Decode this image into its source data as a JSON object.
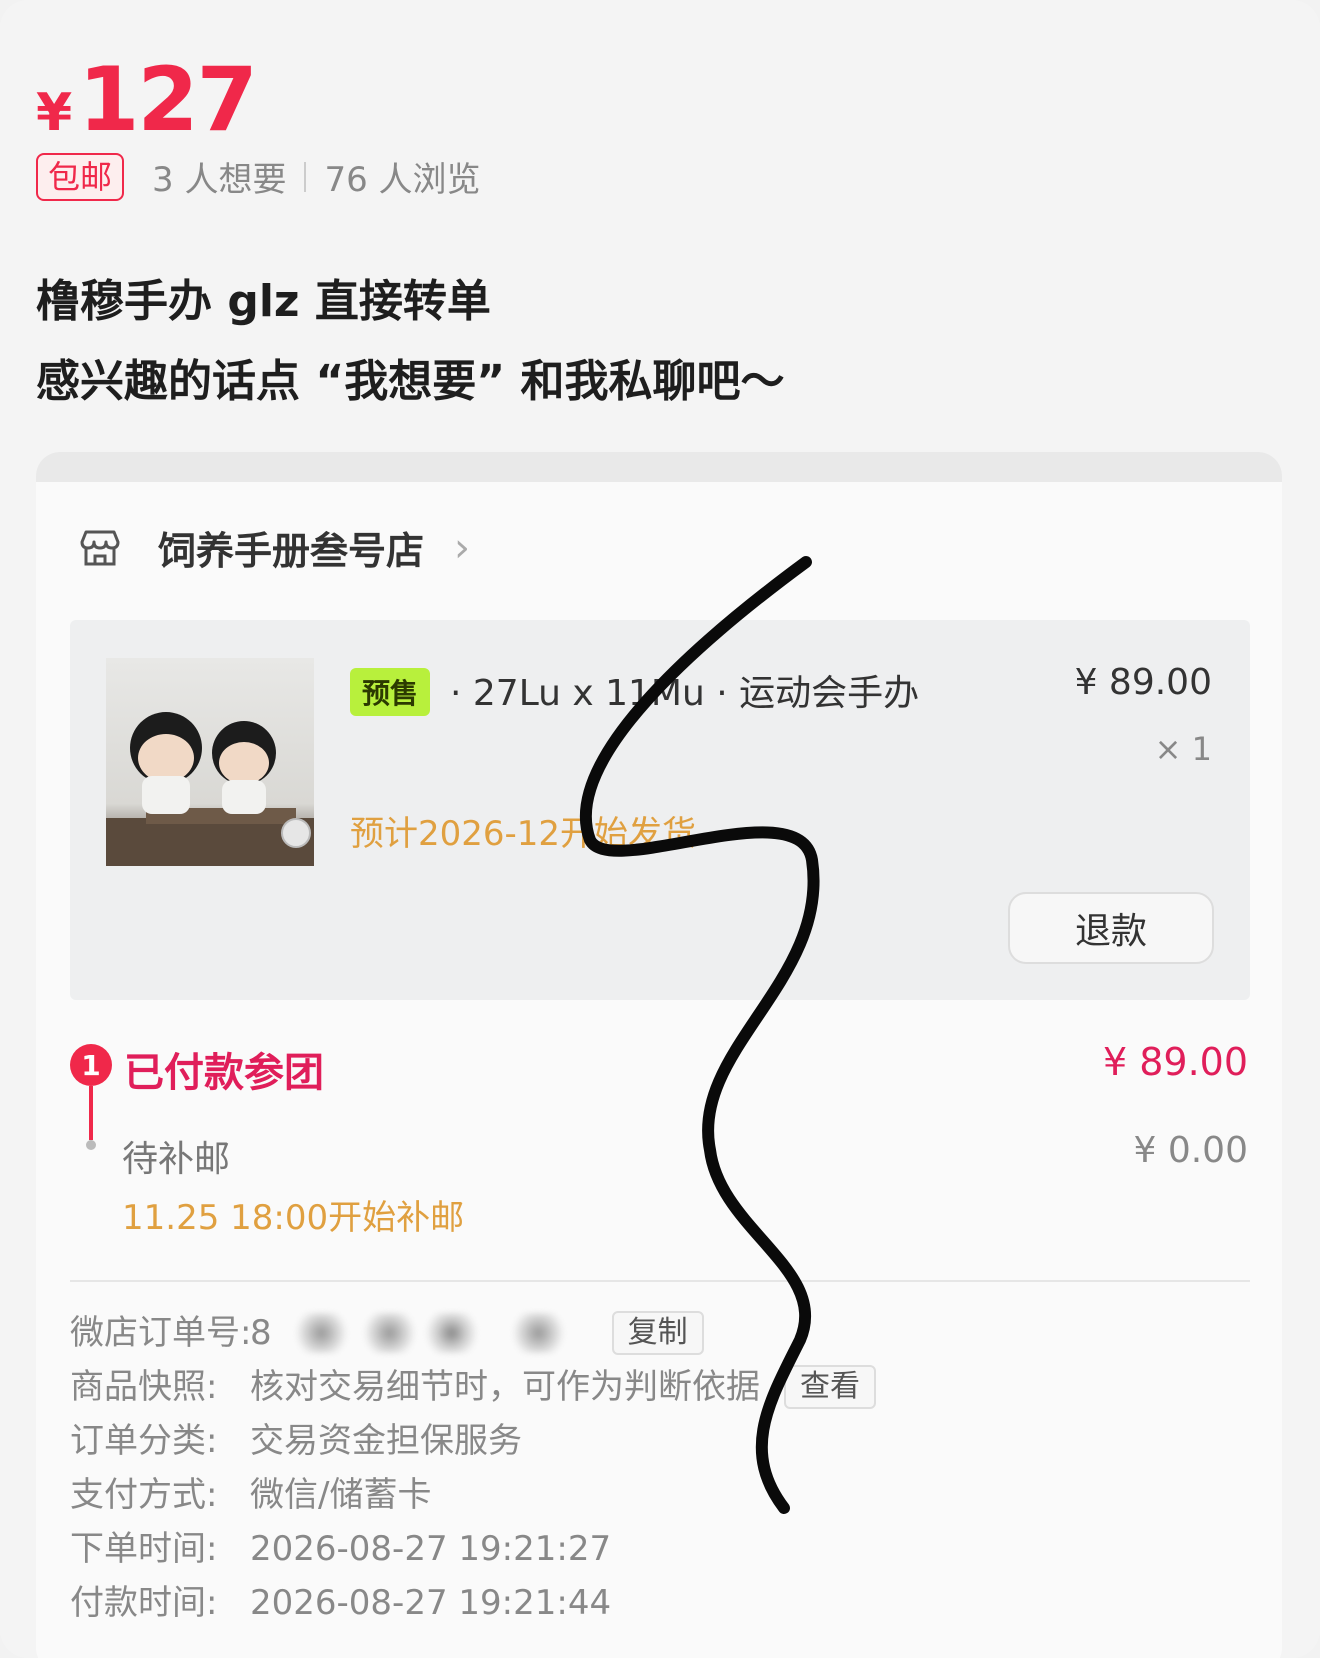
{
  "listing": {
    "currency": "¥",
    "price": "127",
    "shipping_badge": "包邮",
    "wants": "3 人想要",
    "views": "76 人浏览",
    "title_line1": "橹穆手办 glz 直接转单",
    "title_line2": "感兴趣的话点 “我想要” 和我私聊吧～"
  },
  "order": {
    "shop_name": "饲养手册叁号店",
    "presale_tag": "预售",
    "item_title": "· 27Lu x 11Mu · 运动会手办",
    "item_price": "¥ 89.00",
    "item_qty": "× 1",
    "ship_estimate": "预计2026-12开始发货",
    "refund_label": "退款",
    "step1_number": "1",
    "step1_label": "已付款参团",
    "step1_amount": "¥ 89.00",
    "step2_label": "待补邮",
    "step2_amount": "¥ 0.00",
    "step2_note": "11.25 18:00开始补邮",
    "order_no_key": "微店订单号:",
    "order_no_prefix": "8",
    "copy_label": "复制",
    "snapshot_key": "商品快照:",
    "snapshot_val": "核对交易细节时，可作为判断依据",
    "view_label": "查看",
    "category_key": "订单分类:",
    "category_val": "交易资金担保服务",
    "payment_key": "支付方式:",
    "payment_val": "微信/储蓄卡",
    "ordered_key": "下单时间:",
    "ordered_val": "2026-08-27 19:21:27",
    "paid_key": "付款时间:",
    "paid_val": "2026-08-27 19:21:44"
  },
  "colors": {
    "accent_red": "#f0284a",
    "order_red": "#e01e5a",
    "amber": "#e0a040",
    "presale_green": "#b8f03c"
  },
  "icons": {
    "shop": "shop-icon",
    "chevron": "chevron-right-icon"
  }
}
